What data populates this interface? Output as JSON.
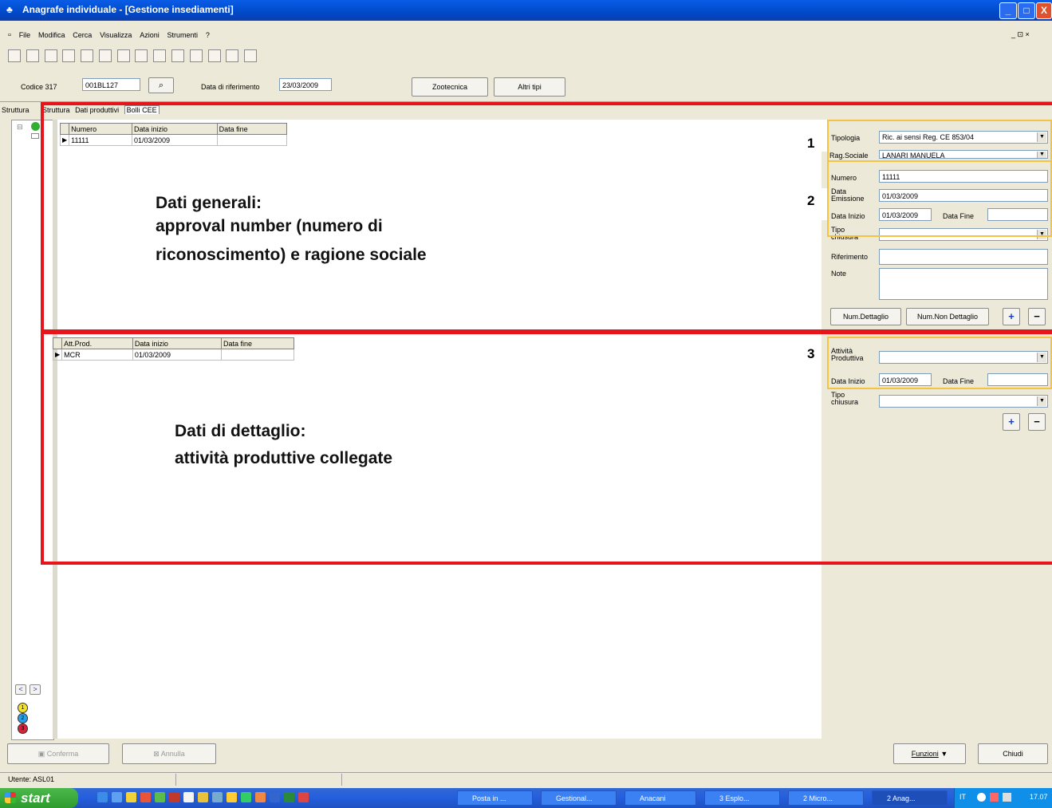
{
  "window": {
    "title": "Anagrafe individuale - [Gestione insediamenti]",
    "min": "_",
    "max": "□",
    "close": "X",
    "mdi_controls": "_ ⊡ ×"
  },
  "menu": [
    "File",
    "Modifica",
    "Cerca",
    "Visualizza",
    "Azioni",
    "Strumenti",
    "?"
  ],
  "header": {
    "codice_label": "Codice 317",
    "codice_value": "001BL127",
    "data_rif_label": "Data di riferimento",
    "data_rif_value": "23/03/2009",
    "zootecnica": "Zootecnica",
    "altri_tipi": "Altri tipi"
  },
  "tabs": {
    "outer": "Struttura",
    "items": [
      "Struttura",
      "Dati produttivi",
      "Bolli CEE"
    ],
    "active": "Bolli CEE"
  },
  "grid1": {
    "headers": [
      "Numero",
      "Data inizio",
      "Data fine"
    ],
    "rows": [
      [
        "11111",
        "01/03/2009",
        ""
      ]
    ]
  },
  "grid2": {
    "headers": [
      "Att.Prod.",
      "Data inizio",
      "Data fine"
    ],
    "rows": [
      [
        "MCR",
        "01/03/2009",
        ""
      ]
    ]
  },
  "form": {
    "tipologia_label": "Tipologia",
    "tipologia_value": "Ric. ai sensi Reg. CE 853/04",
    "rag_sociale_label": "Rag.Sociale",
    "rag_sociale_value": "LANARI MANUELA",
    "numero_label": "Numero",
    "numero_value": "11111",
    "data_emissione_label": "Data Emissione",
    "data_emissione_value": "01/03/2009",
    "data_inizio_label": "Data Inizio",
    "data_inizio_value": "01/03/2009",
    "data_fine_label": "Data Fine",
    "data_fine_value": "",
    "tipo_chiusura_label": "Tipo chiusura",
    "riferimento_label": "Riferimento",
    "note_label": "Note",
    "num_dettaglio": "Num.Dettaglio",
    "num_non_dettaglio": "Num.Non Dettaglio",
    "plus": "+",
    "minus": "−"
  },
  "form2": {
    "attivita_label": "Attività Produttiva",
    "attivita_value": "",
    "data_inizio_label": "Data Inizio",
    "data_inizio_value": "01/03/2009",
    "data_fine_label": "Data Fine",
    "tipo_chiusura_label": "Tipo chiusura",
    "plus": "+",
    "minus": "−"
  },
  "annotations": {
    "n1": "1",
    "n2": "2",
    "n3": "3",
    "generali_1": "Dati generali:",
    "generali_2": "approval number (numero di",
    "generali_3": "riconoscimento) e ragione sociale",
    "dettaglio_1": "Dati di dettaglio:",
    "dettaglio_2": "attività produttive collegate"
  },
  "nav": {
    "prev": "<",
    "next": ">",
    "b1": "1",
    "b2": "2",
    "b3": "3"
  },
  "bottom": {
    "conferma": "Conferma",
    "annulla": "Annulla",
    "funzioni": "Funzioni",
    "chiudi": "Chiudi"
  },
  "status": {
    "utente": "Utente: ASL01"
  },
  "taskbar": {
    "start": "start",
    "tasks": [
      "Posta in ...",
      "Gestional...",
      "Anacani",
      "3 Esplo...",
      "2 Micro...",
      "2 Anag..."
    ],
    "lang": "IT",
    "clock": "17.07"
  },
  "colors": {
    "annotation_red": "#e8141c",
    "annotation_yellow": "#f5c242",
    "titlebar": "#0a5ce6"
  }
}
